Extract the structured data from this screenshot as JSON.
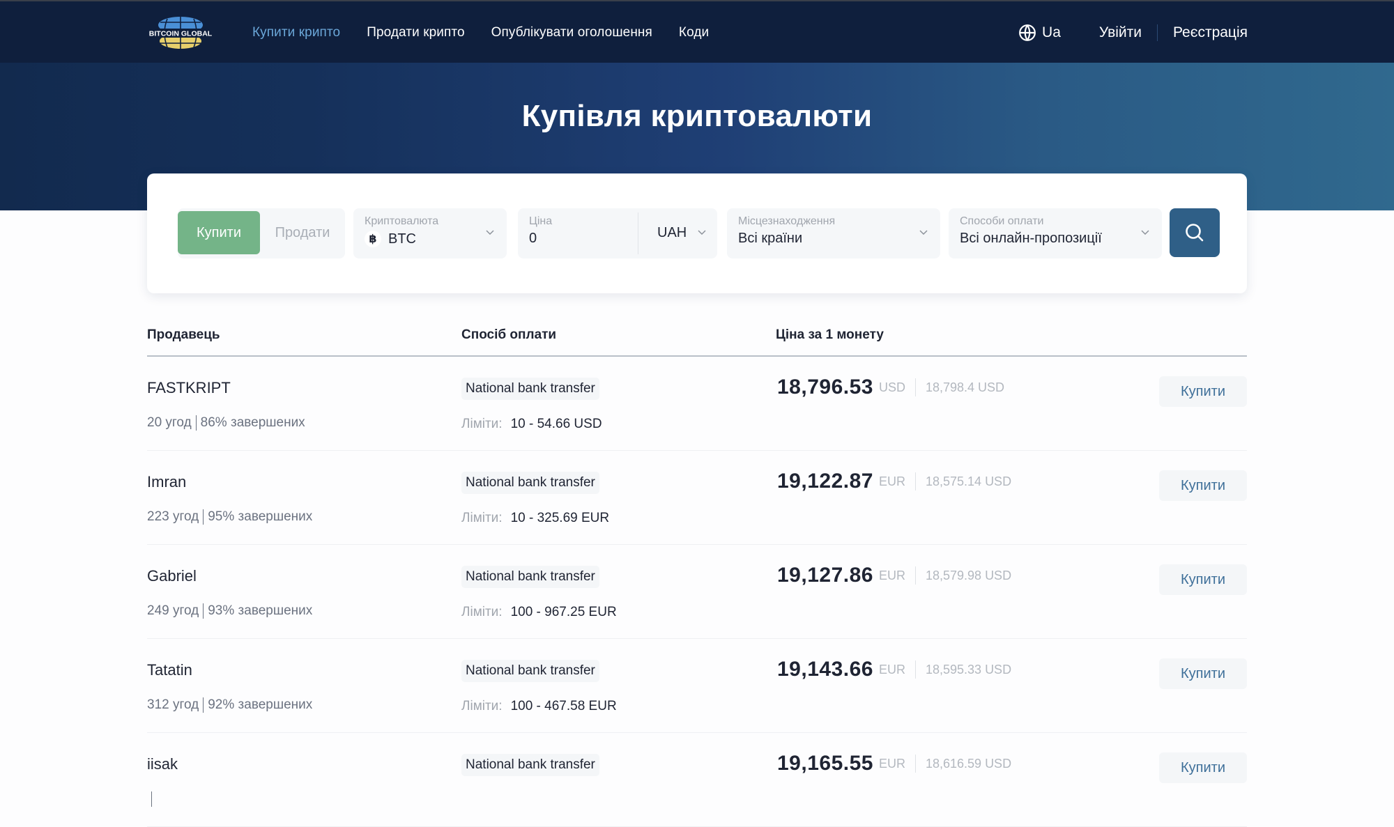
{
  "nav": {
    "logo_text": "BITCOIN GLOBAL",
    "links": [
      {
        "label": "Купити крипто",
        "active": true
      },
      {
        "label": "Продати крипто",
        "active": false
      },
      {
        "label": "Опублікувати оголошення",
        "active": false
      },
      {
        "label": "Коди",
        "active": false
      }
    ],
    "language": "Ua",
    "language_icon": "globe-icon",
    "login": "Увійти",
    "register": "Реєстрація"
  },
  "hero": {
    "title": "Купівля криптовалюти"
  },
  "filters": {
    "buy_label": "Купити",
    "sell_label": "Продати",
    "crypto": {
      "label": "Криптовалюта",
      "value": "BTC",
      "icon_glyph": "฿"
    },
    "price": {
      "label": "Ціна",
      "value": "0",
      "currency": "UAH"
    },
    "location": {
      "label": "Місцезнаходження",
      "value": "Всі країни"
    },
    "payment": {
      "label": "Способи оплати",
      "value": "Всі онлайн-пропозиції"
    },
    "search_icon": "search-icon"
  },
  "table": {
    "headers": {
      "seller": "Продавець",
      "payment": "Спосіб оплати",
      "price": "Ціна за 1 монету"
    },
    "limits_label": "Ліміти:",
    "buy_label": "Купити",
    "rows": [
      {
        "seller": "FASTKRIPT",
        "deals": "20 угод",
        "completed": "86% завершених",
        "payment": "National bank transfer",
        "limits": "10 - 54.66 USD",
        "price": "18,796.53",
        "currency": "USD",
        "alt_price": "18,798.4 USD"
      },
      {
        "seller": "Imran",
        "deals": "223 угод",
        "completed": "95% завершених",
        "payment": "National bank transfer",
        "limits": "10 - 325.69 EUR",
        "price": "19,122.87",
        "currency": "EUR",
        "alt_price": "18,575.14 USD"
      },
      {
        "seller": "Gabriel",
        "deals": "249 угод",
        "completed": "93% завершених",
        "payment": "National bank transfer",
        "limits": "100 - 967.25 EUR",
        "price": "19,127.86",
        "currency": "EUR",
        "alt_price": "18,579.98 USD"
      },
      {
        "seller": "Tatatin",
        "deals": "312 угод",
        "completed": "92% завершених",
        "payment": "National bank transfer",
        "limits": "100 - 467.58 EUR",
        "price": "19,143.66",
        "currency": "EUR",
        "alt_price": "18,595.33 USD"
      },
      {
        "seller": "iisak",
        "deals": "",
        "completed": "",
        "payment": "National bank transfer",
        "limits": "",
        "price": "19,165.55",
        "currency": "EUR",
        "alt_price": "18,616.59 USD"
      }
    ]
  },
  "colors": {
    "nav_bg": "#0f1f3d",
    "nav_active": "#6ba7d9",
    "buy_toggle": "#74b488",
    "search_button": "#2f5f87",
    "buy_button_text": "#3e6f99"
  }
}
